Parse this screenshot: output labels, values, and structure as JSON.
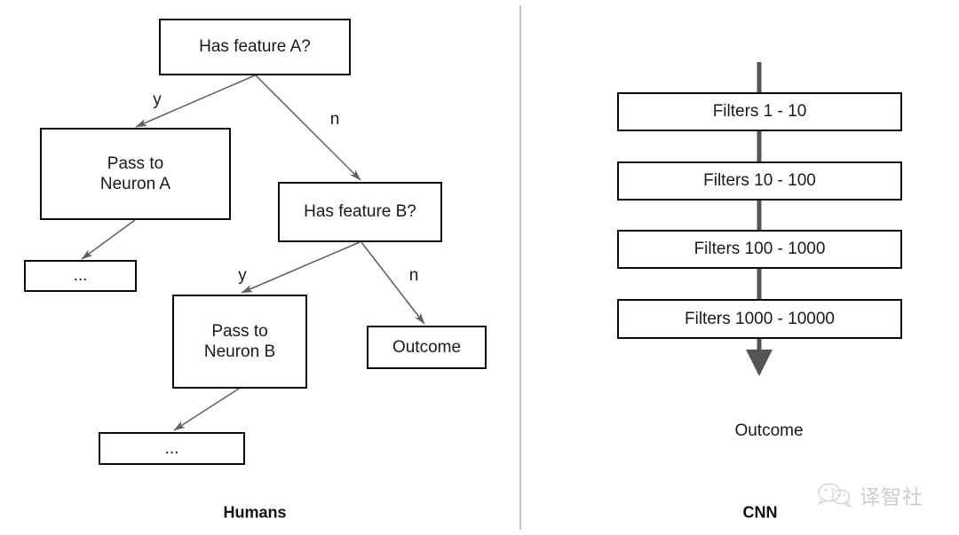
{
  "figure": {
    "background_color": "#ffffff",
    "box_border_color": "#0a0a0a",
    "arrow_color_left": "#606060",
    "arrow_color_right": "#555555",
    "divider_color": "#b0b0b0"
  },
  "left_panel": {
    "caption": "Humans",
    "nodes": [
      {
        "id": "has-feature-a",
        "label": "Has feature A?"
      },
      {
        "id": "pass-to-neuron-a",
        "label": "Pass to\nNeuron A"
      },
      {
        "id": "ellipsis-a",
        "label": "..."
      },
      {
        "id": "has-feature-b",
        "label": "Has feature B?"
      },
      {
        "id": "pass-to-neuron-b",
        "label": "Pass to\nNeuron B"
      },
      {
        "id": "ellipsis-b",
        "label": "..."
      },
      {
        "id": "outcome-box",
        "label": "Outcome"
      }
    ],
    "edge_labels": [
      {
        "id": "edge-a-yes",
        "label": "y"
      },
      {
        "id": "edge-a-no",
        "label": "n"
      },
      {
        "id": "edge-b-yes",
        "label": "y"
      },
      {
        "id": "edge-b-no",
        "label": "n"
      }
    ]
  },
  "right_panel": {
    "caption": "CNN",
    "nodes": [
      {
        "id": "filters-1-10",
        "label": "Filters 1 - 10"
      },
      {
        "id": "filters-10-100",
        "label": "Filters 10 - 100"
      },
      {
        "id": "filters-100-1000",
        "label": "Filters 100 - 1000"
      },
      {
        "id": "filters-1000-10000",
        "label": "Filters 1000 - 10000"
      }
    ],
    "outcome_label": "Outcome"
  },
  "watermark": {
    "icon": "wechat-icon",
    "text": "译智社"
  }
}
